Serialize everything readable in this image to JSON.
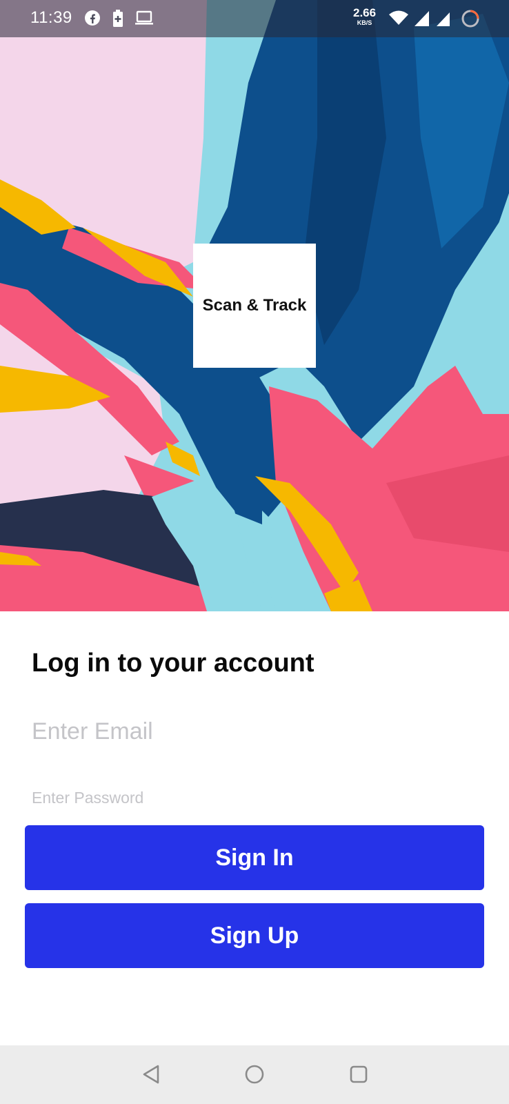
{
  "status_bar": {
    "time": "11:39",
    "net_speed_value": "2.66",
    "net_speed_unit": "KB/S",
    "icons": [
      "facebook-icon",
      "battery-saver-icon",
      "laptop-icon",
      "wifi-icon",
      "signal-icon",
      "signal-icon",
      "loading-ring-icon"
    ]
  },
  "logo": {
    "text": "Scan & Track"
  },
  "login_form": {
    "title": "Log in to your account",
    "email_placeholder": "Enter Email",
    "password_placeholder": "Enter Password",
    "sign_in_label": "Sign In",
    "sign_up_label": "Sign Up"
  },
  "colors": {
    "button": "#2633e8",
    "hero_pink": "#f4d6ea",
    "hero_light_blue": "#8fd9e6",
    "hero_navy": "#0d4f8c",
    "hero_red": "#f5577a",
    "hero_yellow": "#f6b800",
    "hero_dark": "#26304d"
  },
  "nav_bar": {
    "icons": [
      "back-triangle-icon",
      "home-circle-icon",
      "recents-square-icon"
    ]
  }
}
